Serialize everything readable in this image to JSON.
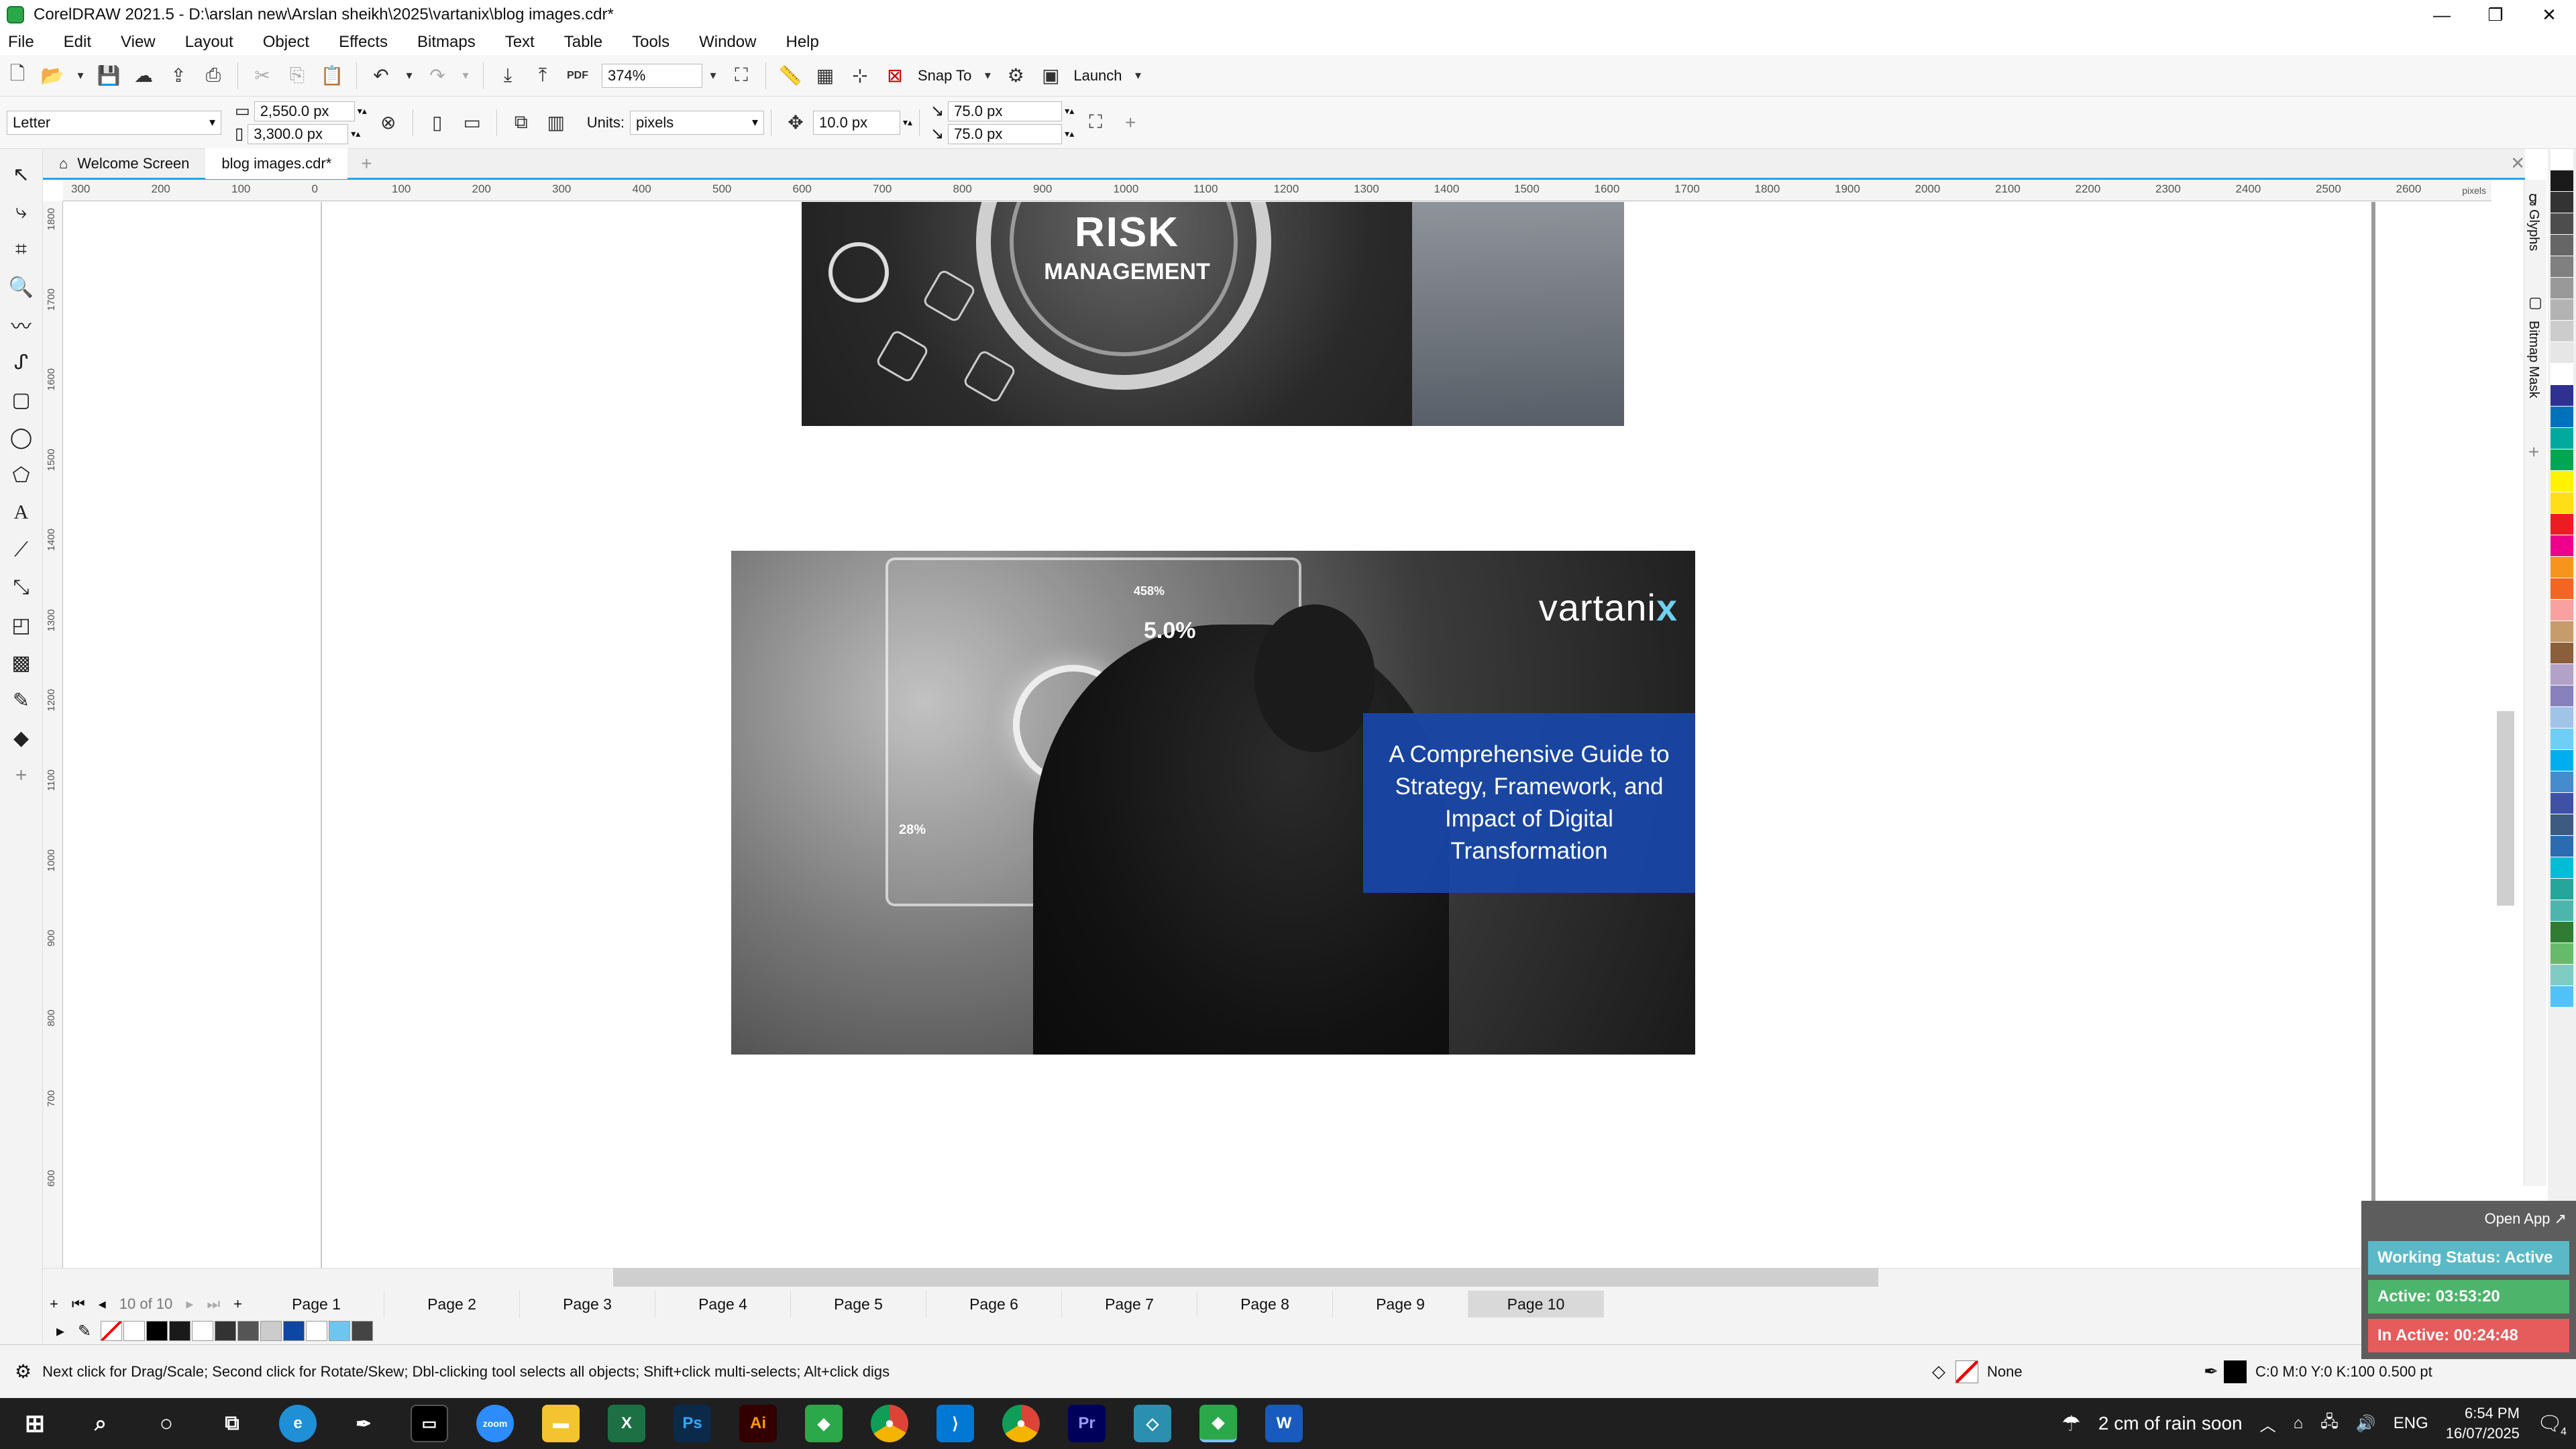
{
  "window": {
    "title": "CorelDRAW 2021.5 - D:\\arslan new\\Arslan sheikh\\2025\\vartanix\\blog images.cdr*"
  },
  "menu": [
    "File",
    "Edit",
    "View",
    "Layout",
    "Object",
    "Effects",
    "Bitmaps",
    "Text",
    "Table",
    "Tools",
    "Window",
    "Help"
  ],
  "toolbar1": {
    "zoom": "374%",
    "snap_to": "Snap To",
    "launch": "Launch",
    "pdf": "PDF"
  },
  "toolbar2": {
    "page_size": "Letter",
    "width": "2,550.0 px",
    "height": "3,300.0 px",
    "units_label": "Units:",
    "units": "pixels",
    "nudge": "10.0 px",
    "dup_x": "75.0 px",
    "dup_y": "75.0 px"
  },
  "doc_tabs": {
    "welcome": "Welcome Screen",
    "file": "blog images.cdr*"
  },
  "ruler_h": [
    "300",
    "200",
    "100",
    "0",
    "100",
    "200",
    "300",
    "400",
    "500",
    "600",
    "700",
    "800",
    "900",
    "1000",
    "1100",
    "1200",
    "1300",
    "1400",
    "1500",
    "1600",
    "1700",
    "1800",
    "1900",
    "2000",
    "2100",
    "2200",
    "2300",
    "2400",
    "2500",
    "2600"
  ],
  "ruler_v": [
    "1800",
    "1700",
    "1600",
    "1500",
    "1400",
    "1300",
    "1200",
    "1100",
    "1000",
    "900",
    "800",
    "700",
    "600"
  ],
  "ruler_units": "pixels",
  "image1": {
    "title_line1": "RISK",
    "title_line2": "MANAGEMENT"
  },
  "image2": {
    "stat1": "458%",
    "stat2": "5.0%",
    "stat3": "28%",
    "logo": "vartani",
    "logo_x": "x",
    "callout": "A Comprehensive Guide to Strategy, Framework, and Impact of Digital Transformation"
  },
  "docker": {
    "glyphs": "Glyphs",
    "bitmap_mask": "Bitmap Mask"
  },
  "page_nav": {
    "current": "10",
    "of": "of",
    "total": "10"
  },
  "pages": [
    "Page 1",
    "Page 2",
    "Page 3",
    "Page 4",
    "Page 5",
    "Page 6",
    "Page 7",
    "Page 8",
    "Page 9",
    "Page 10"
  ],
  "status": {
    "hint": "Next click for Drag/Scale; Second click for Rotate/Skew; Dbl-clicking tool selects all objects; Shift+click multi-selects; Alt+click digs",
    "fill": "None",
    "outline": "C:0 M:0 Y:0 K:100  0.500 pt"
  },
  "widget": {
    "open": "Open App ↗",
    "working": "Working Status: Active",
    "active": "Active: 03:53:20",
    "inactive": "In Active: 00:24:48"
  },
  "taskbar": {
    "weather": "2 cm of rain soon",
    "lang": "ENG",
    "time": "6:54 PM",
    "date": "16/07/2025",
    "notifications": "4"
  },
  "palette_colors": [
    "#ffffff",
    "#1a1a1a",
    "#333333",
    "#4d4d4d",
    "#666666",
    "#808080",
    "#999999",
    "#b3b3b3",
    "#cccccc",
    "#e6e6e6",
    "#ffffff",
    "#2e3192",
    "#0072bc",
    "#00a99d",
    "#00a651",
    "#fff200",
    "#ffde17",
    "#ed1c24",
    "#ec008c",
    "#f7941d",
    "#f26522",
    "#f9a1a1",
    "#c69c6d",
    "#8b5e3c",
    "#b3a2c7",
    "#8781bd",
    "#a0c4e8",
    "#6dcff6",
    "#00aeef",
    "#448ccb",
    "#3f51a5",
    "#3d5a80",
    "#2b6cb0",
    "#00bcd4",
    "#26a69a",
    "#4db6ac",
    "#2e7d32",
    "#66bb6a",
    "#80cbc4",
    "#4fc3f7"
  ],
  "doc_palette": [
    "#ffffff",
    "#000000",
    "#1a1a1a",
    "#ffffff",
    "#333333",
    "#555555",
    "#cccccc",
    "#0d47a1",
    "#ffffff",
    "#6ec6f0",
    "#444444"
  ]
}
